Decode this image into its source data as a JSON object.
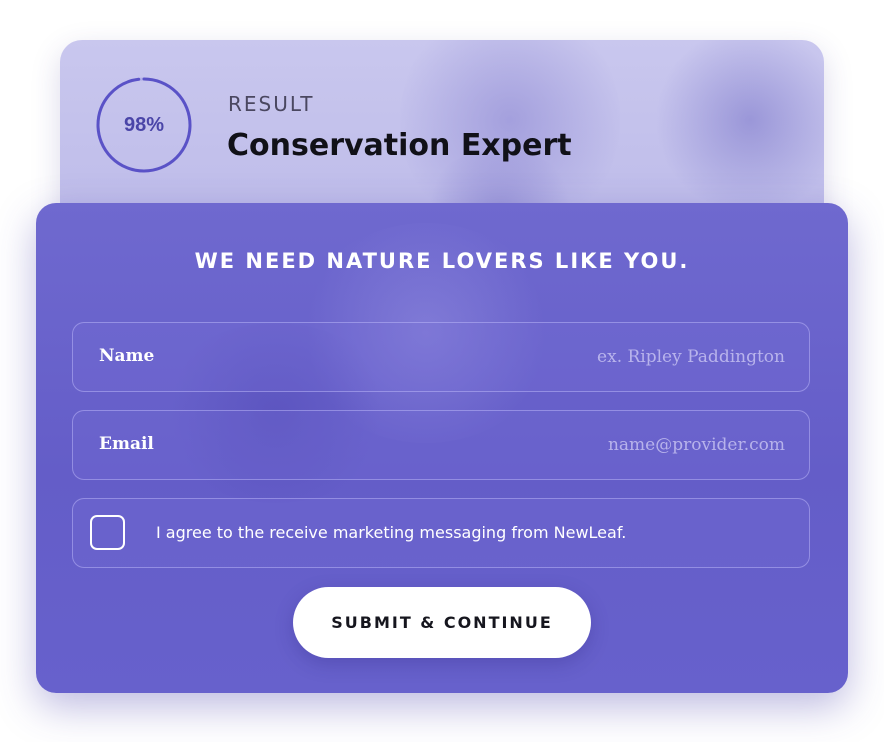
{
  "result": {
    "score_text": "98%",
    "score_fraction": 0.98,
    "label": "RESULT",
    "title": "Conservation Expert"
  },
  "form": {
    "headline": "WE NEED NATURE LOVERS LIKE YOU.",
    "name": {
      "label": "Name",
      "value": "",
      "placeholder": "ex. Ripley Paddington"
    },
    "email": {
      "label": "Email",
      "value": "",
      "placeholder": "name@provider.com"
    },
    "consent": {
      "checked": false,
      "text": "I agree to the receive marketing messaging from NewLeaf."
    },
    "submit_label": "SUBMIT & CONTINUE"
  },
  "colors": {
    "accent": "#5a52c7",
    "card_bg": "#6a64cd",
    "result_bg": "#c3c1ec",
    "button_bg": "#ffffff",
    "button_text": "#16161e"
  }
}
